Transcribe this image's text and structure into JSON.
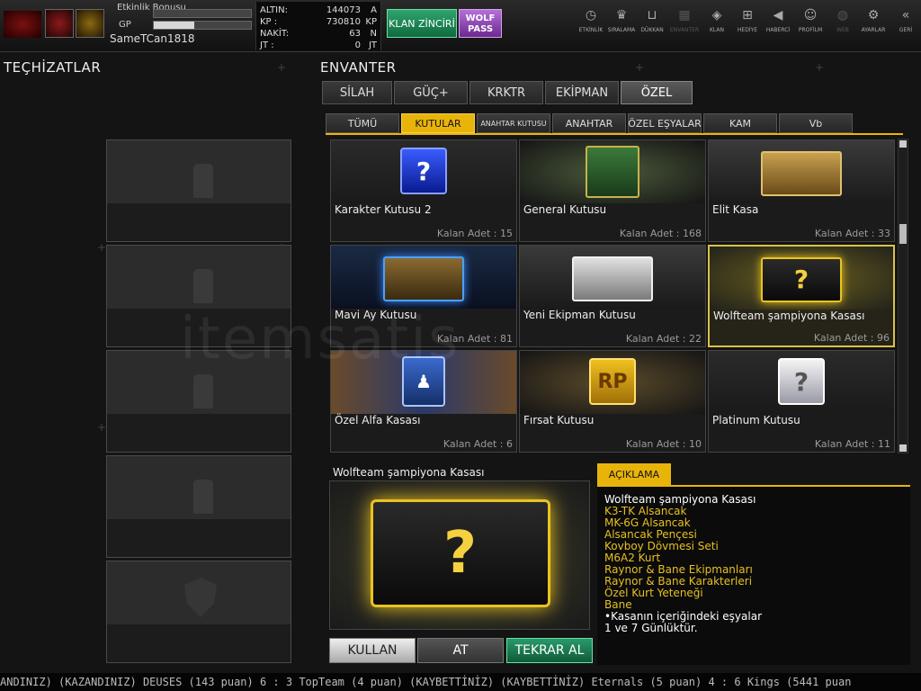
{
  "header": {
    "username": "SameTCan1818",
    "event_bonus_label": "Etkinlik Bonusu",
    "event_bonus_progress": 0,
    "gp_label": "GP",
    "gp_progress": 0.42,
    "currencies": [
      {
        "name": "ALTIN:",
        "value": "144073",
        "unit": "A"
      },
      {
        "name": "KP   :",
        "value": "730810",
        "unit": "KP"
      },
      {
        "name": "NAKİT:",
        "value": "63",
        "unit": "N"
      },
      {
        "name": "JT    :",
        "value": "0",
        "unit": "JT"
      }
    ],
    "klan_button": "KLAN ZİNCİRİ",
    "wolf_pass_button": "WOLF PASS",
    "nav": [
      {
        "label": "ETKİNLİK",
        "icon": "stopwatch-icon",
        "glyph": "◷"
      },
      {
        "label": "SIRALAMA",
        "icon": "rank-medal-icon",
        "glyph": "♛"
      },
      {
        "label": "DÜKKAN",
        "icon": "shopping-cart-icon",
        "glyph": "⊔"
      },
      {
        "label": "ENVANTER",
        "icon": "inventory-icon",
        "glyph": "▦"
      },
      {
        "label": "KLAN",
        "icon": "clan-shield-icon",
        "glyph": "◈"
      },
      {
        "label": "HEDİYE",
        "icon": "gift-icon",
        "glyph": "⊞"
      },
      {
        "label": "HABERCİ",
        "icon": "megaphone-icon",
        "glyph": "◀"
      },
      {
        "label": "PROFİLM",
        "icon": "profile-icon",
        "glyph": "☺"
      },
      {
        "label": "WEB",
        "icon": "globe-icon",
        "glyph": "◍"
      },
      {
        "label": "AYARLAR",
        "icon": "gear-icon",
        "glyph": "⚙"
      },
      {
        "label": "GERİ",
        "icon": "back-chevron-icon",
        "glyph": "«"
      }
    ]
  },
  "left_panel": {
    "title": "TEÇHİZATLAR"
  },
  "inventory": {
    "title": "ENVANTER",
    "tabs": [
      "SİLAH",
      "GÜÇ+",
      "KRKTR",
      "EKİPMAN",
      "ÖZEL"
    ],
    "active_tab": "ÖZEL",
    "subtabs": [
      "TÜMÜ",
      "KUTULAR",
      "ANAHTAR KUTUSU",
      "ANAHTAR",
      "ÖZEL EŞYALAR",
      "KAM",
      "Vb"
    ],
    "active_subtab": "KUTULAR",
    "items": [
      {
        "name": "Karakter Kutusu 2",
        "count": "Kalan Adet : 15"
      },
      {
        "name": "General Kutusu",
        "count": "Kalan Adet : 168"
      },
      {
        "name": "Elit Kasa",
        "count": "Kalan Adet : 33"
      },
      {
        "name": "Mavi Ay Kutusu",
        "count": "Kalan Adet : 81"
      },
      {
        "name": "Yeni Ekipman Kutusu",
        "count": "Kalan Adet : 22"
      },
      {
        "name": "Wolfteam şampiyona Kasası",
        "count": "Kalan Adet : 96"
      },
      {
        "name": "Özel Alfa Kasası",
        "count": "Kalan Adet : 6"
      },
      {
        "name": "Fırsat Kutusu",
        "count": "Kalan Adet : 10"
      },
      {
        "name": "Platinum Kutusu",
        "count": "Kalan Adet : 11"
      }
    ]
  },
  "detail": {
    "title": "Wolfteam şampiyona Kasası",
    "use_button": "KULLAN",
    "drop_button": "AT",
    "rebuy_button": "TEKRAR AL",
    "description_tab": "AÇIKLAMA",
    "description": [
      "Wolfteam şampiyona Kasası",
      "K3-TK Alsancak",
      "MK-6G Alsancak",
      "Alsancak Pençesi",
      "Kovboy Dövmesi Seti",
      "M6A2 Kurt",
      "Raynor & Bane Ekipmanları",
      "Raynor & Bane Karakterleri",
      "Özel Kurt Yeteneği",
      "Bane",
      "•Kasanın içeriğindeki eşyalar",
      "1 ve 7 Günlüktür."
    ]
  },
  "ticker": "ANDINIZ)  (KAZANDINIZ) DEUSES (143 puan) 6 : 3 TopTeam (4 puan) (KAYBETTİNİZ)    (KAYBETTİNİZ) Eternals (5 puan) 4 : 6 Kings (5441 puan",
  "watermark": "itemsatis"
}
